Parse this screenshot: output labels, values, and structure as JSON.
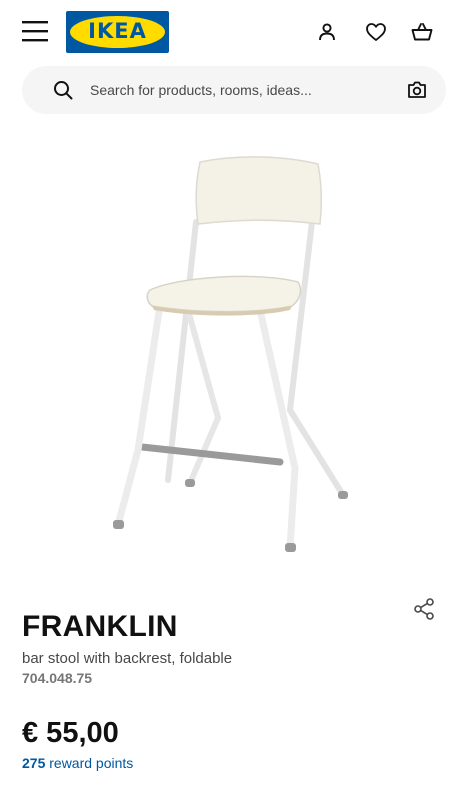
{
  "header": {
    "menu_icon": "hamburger-menu-icon",
    "logo_text": "IKEA",
    "account_icon": "person-icon",
    "favourites_icon": "heart-icon",
    "cart_icon": "shopping-bag-icon"
  },
  "search": {
    "placeholder": "Search for products, rooms, ideas...",
    "search_icon": "magnifier-icon",
    "camera_icon": "camera-icon"
  },
  "product": {
    "image_icon": "bar-stool-image",
    "name": "FRANKLIN",
    "description": "bar stool with backrest, foldable",
    "article_number": "704.048.75",
    "price": "€ 55,00",
    "reward_points": "275",
    "reward_label": " reward points",
    "share_icon": "share-icon"
  },
  "colors": {
    "brand_blue": "#0058a3",
    "brand_yellow": "#ffdb00",
    "text_primary": "#111111",
    "text_secondary": "#484848",
    "text_muted": "#767676"
  }
}
